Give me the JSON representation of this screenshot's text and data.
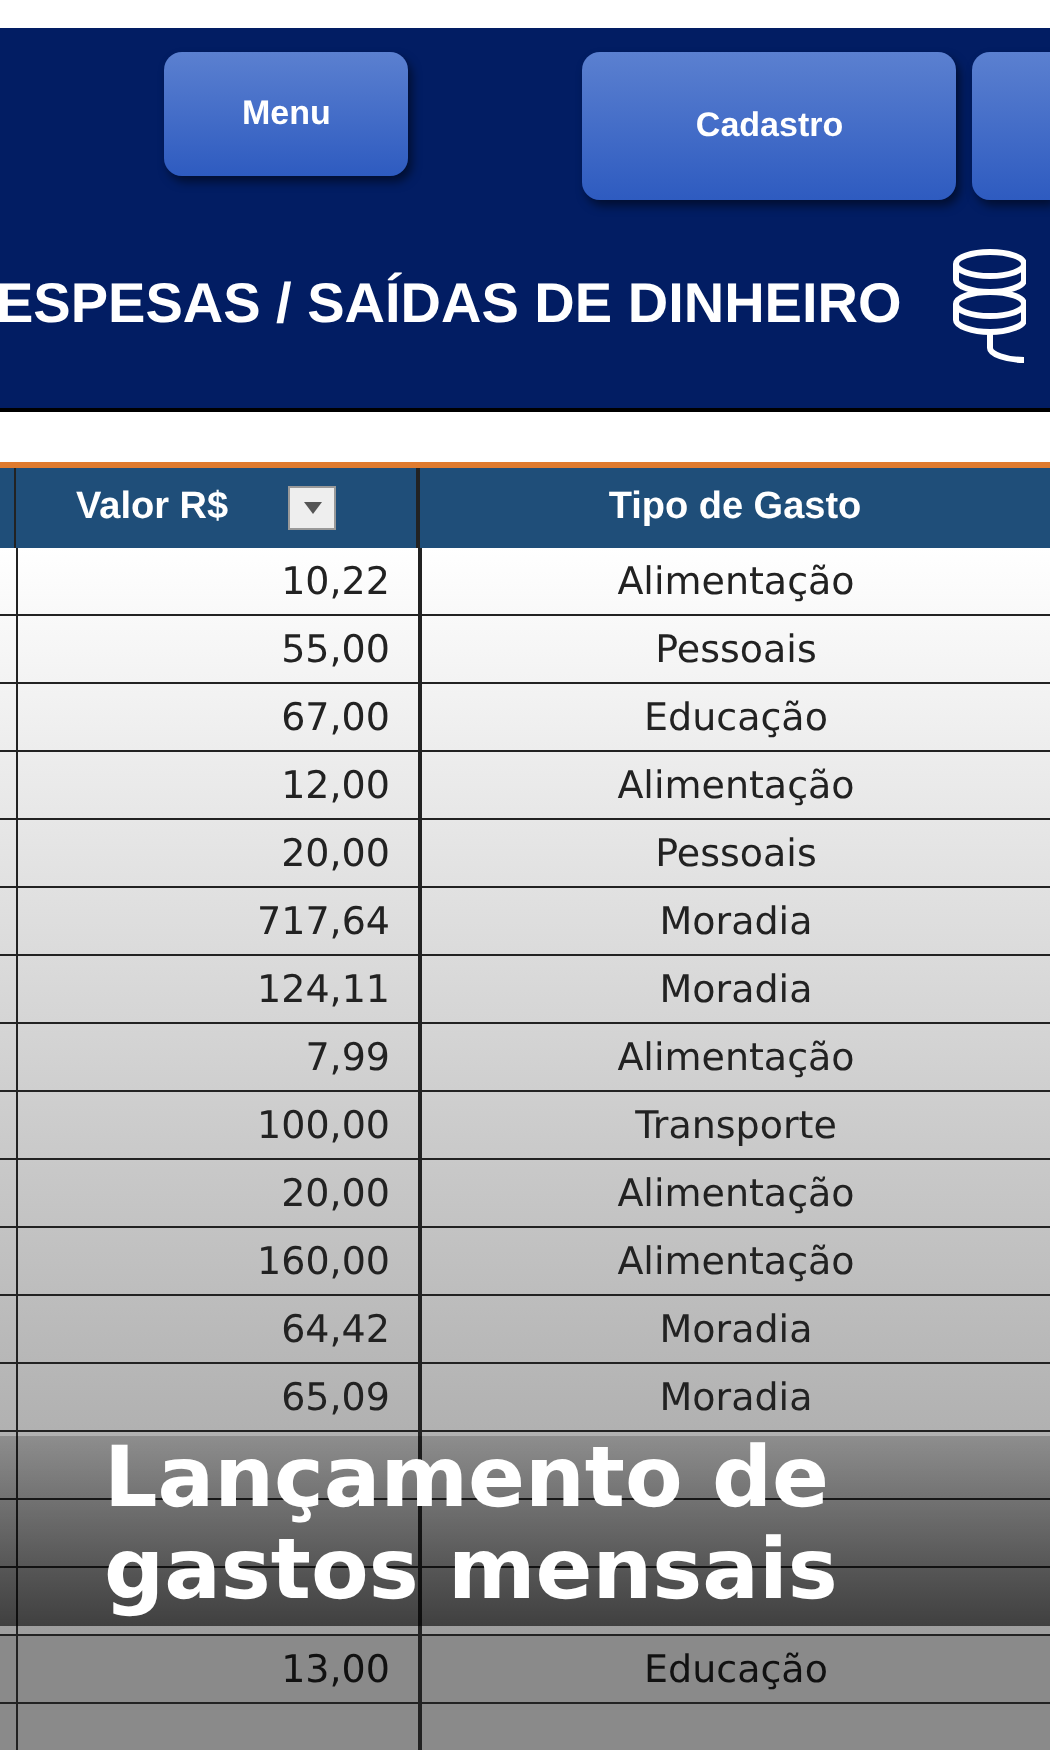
{
  "banner": {
    "buttons": [
      {
        "label": "Menu"
      },
      {
        "label": "Cadastro"
      }
    ],
    "title": "ESPESAS / SAÍDAS DE DINHEIRO"
  },
  "table": {
    "columns": [
      "Valor R$",
      "Tipo de Gasto"
    ],
    "rows": [
      {
        "value": "10,22",
        "type": "Alimentação"
      },
      {
        "value": "55,00",
        "type": "Pessoais"
      },
      {
        "value": "67,00",
        "type": "Educação"
      },
      {
        "value": "12,00",
        "type": "Alimentação"
      },
      {
        "value": "20,00",
        "type": "Pessoais"
      },
      {
        "value": "717,64",
        "type": "Moradia"
      },
      {
        "value": "124,11",
        "type": "Moradia"
      },
      {
        "value": "7,99",
        "type": "Alimentação"
      },
      {
        "value": "100,00",
        "type": "Transporte"
      },
      {
        "value": "20,00",
        "type": "Alimentação"
      },
      {
        "value": "160,00",
        "type": "Alimentação"
      },
      {
        "value": "64,42",
        "type": "Moradia"
      },
      {
        "value": "65,09",
        "type": "Moradia"
      }
    ],
    "lower_rows": [
      {
        "value": "13,00",
        "type": "Educação"
      }
    ]
  },
  "caption": "Lançamento de gastos mensais"
}
